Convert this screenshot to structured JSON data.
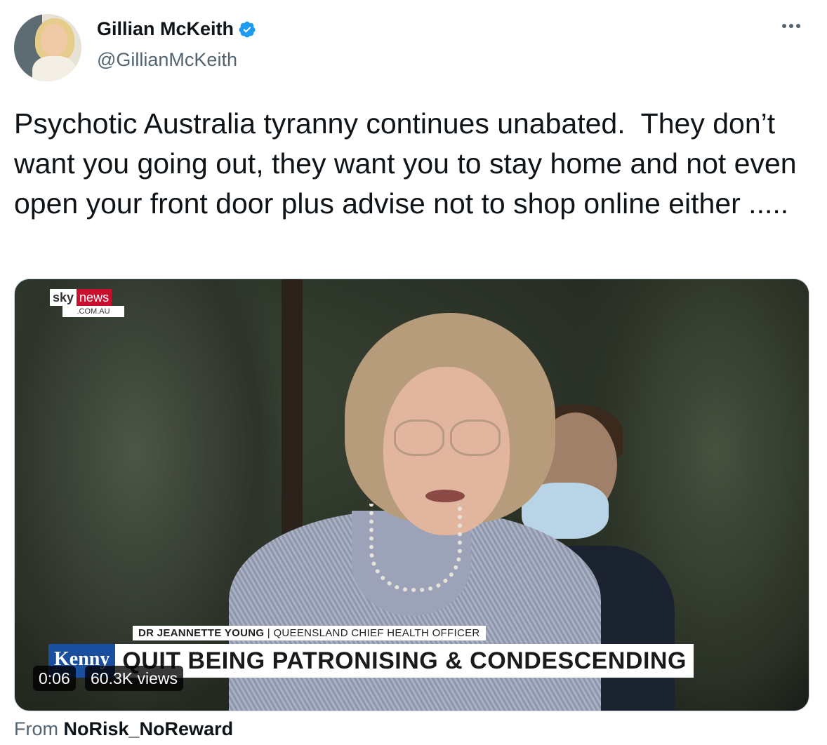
{
  "author": {
    "display_name": "Gillian McKeith",
    "handle": "@GillianMcKeith",
    "verified": true,
    "verified_icon": "verified-badge-icon",
    "verified_color": "#1d9bf0"
  },
  "tweet": {
    "text": "Psychotic Australia tyranny continues unabated.  They don’t want you going out, they want you to stay home and not even  open your front door plus advise not to shop online either ....."
  },
  "media": {
    "logo": {
      "sky": "sky",
      "news": "news",
      "domain": ".COM.AU"
    },
    "caption_name": "DR JEANNETTE YOUNG",
    "caption_title": "| QUEENSLAND CHIEF HEALTH OFFICER",
    "show_tag": "Kenny",
    "headline": "QUIT BEING PATRONISING & CONDESCENDING",
    "duration": "0:06",
    "views": "60.3K views"
  },
  "source": {
    "prefix": "From",
    "name": "NoRisk_NoReward"
  },
  "more_icon": "more-options-icon"
}
